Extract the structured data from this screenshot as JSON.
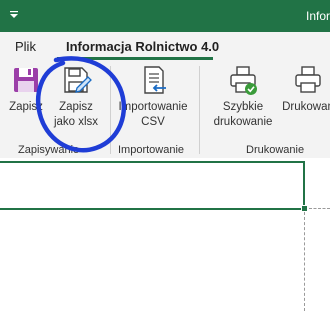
{
  "window": {
    "app_title": "Infor",
    "qat_dropdown_icon": "chevron-down-icon"
  },
  "tabs": [
    {
      "label": "Plik",
      "active": false
    },
    {
      "label": "Informacja Rolnictwo 4.0",
      "active": true
    }
  ],
  "ribbon": {
    "groups": [
      {
        "label": "Zapisywanie",
        "buttons": [
          {
            "label": "Zapisz",
            "icon": "save-icon"
          },
          {
            "label": "Zapisz\njako xlsx",
            "icon": "save-as-edit-icon"
          }
        ]
      },
      {
        "label": "Importowanie",
        "buttons": [
          {
            "label": "Importowanie\nCSV",
            "icon": "import-csv-icon"
          }
        ]
      },
      {
        "label": "Drukowanie",
        "buttons": [
          {
            "label": "Szybkie\ndrukowanie",
            "icon": "quick-print-icon"
          },
          {
            "label": "Drukowan",
            "icon": "printer-icon"
          }
        ]
      }
    ]
  },
  "colors": {
    "title_bar": "#217346",
    "selection": "#217346",
    "annotation_ink": "#1f3dd6",
    "save_icon": "#9b3fa8"
  }
}
